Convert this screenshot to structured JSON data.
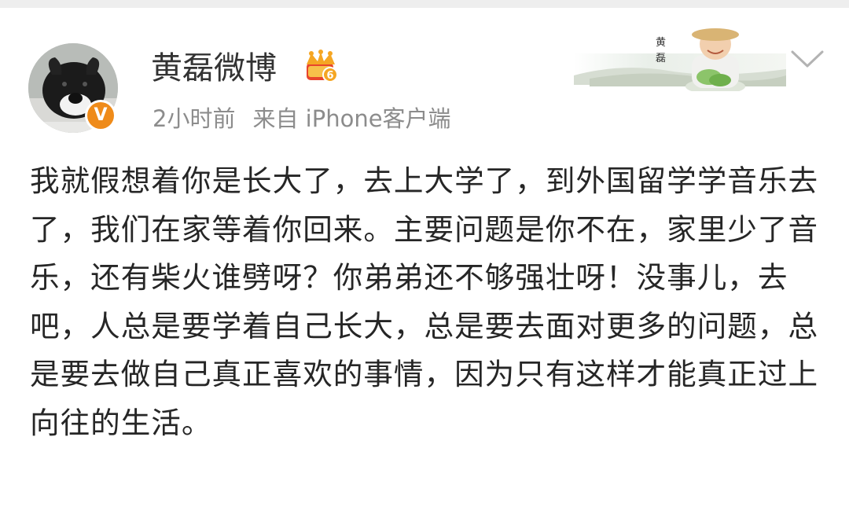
{
  "post": {
    "author": "黄磊微博",
    "time": "2小时前",
    "source": "来自 iPhone客户端",
    "verified_mark": "V",
    "vip_level": "6",
    "content": "我就假想着你是长大了，去上大学了，到外国留学学音乐去了，我们在家等着你回来。主要问题是你不在，家里少了音乐，还有柴火谁劈呀？你弟弟还不够强壮呀！没事儿，去吧，人总是要学着自己长大，总是要去面对更多的问题，总是要去做自己真正喜欢的事情，因为只有这样才能真正过上向往的生活。"
  },
  "card_decoration": {
    "label": "黄磊"
  },
  "icons": {
    "avatar": "dog-avatar",
    "verified": "verified-badge-icon",
    "vip": "crown-vip-icon",
    "more": "chevron-down-icon"
  },
  "colors": {
    "verified_orange": "#ef8b1a",
    "vip_gold": "#f5a623",
    "vip_red": "#e8452c",
    "text_main": "#262626",
    "text_meta": "#8c8c8c"
  }
}
